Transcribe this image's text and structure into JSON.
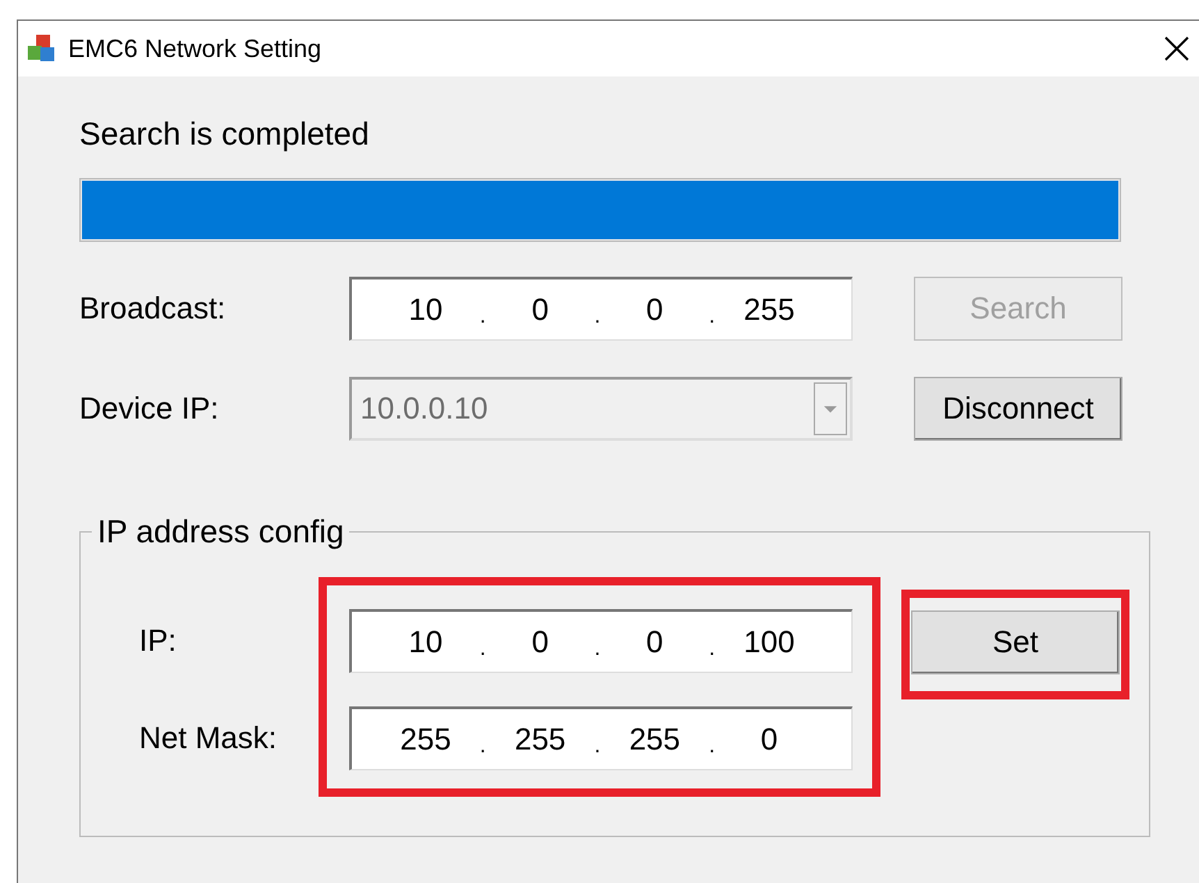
{
  "window": {
    "title": "EMC6 Network Setting"
  },
  "status_text": "Search is completed",
  "progress": {
    "level": 1
  },
  "broadcast": {
    "label": "Broadcast:",
    "octets": [
      "10",
      "0",
      "0",
      "255"
    ],
    "separators": [
      ".",
      ".",
      "."
    ],
    "button": {
      "label": "Search",
      "disabled": true
    }
  },
  "device_ip": {
    "label": "Device IP:",
    "value": "10.0.0.10",
    "disabled": true,
    "button": {
      "label": "Disconnect",
      "disabled": false
    }
  },
  "ip_config": {
    "legend": "IP address config",
    "highlighted": true,
    "fields": [
      {
        "label": "IP:",
        "octets": [
          "10",
          "0",
          "0",
          "100"
        ],
        "separators": [
          ".",
          ".",
          "."
        ]
      },
      {
        "label": "Net Mask:",
        "octets": [
          "255",
          "255",
          "255",
          "0"
        ],
        "separators": [
          ".",
          ".",
          "."
        ]
      }
    ],
    "set_button": {
      "label": "Set",
      "disabled": false,
      "highlighted": true
    }
  }
}
